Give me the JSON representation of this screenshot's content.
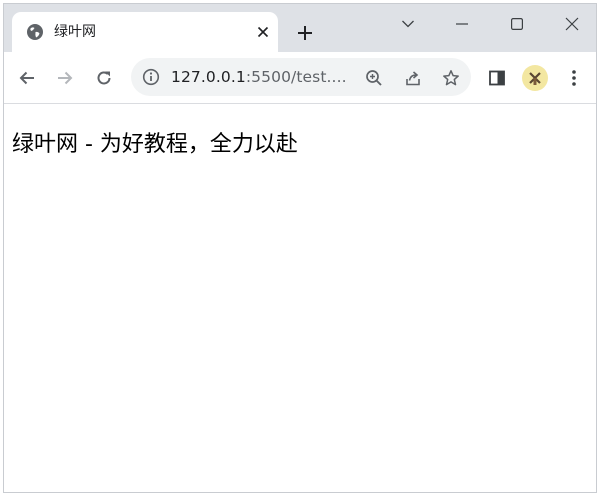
{
  "browser": {
    "tab": {
      "title": "绿叶网",
      "favicon": "globe-icon"
    },
    "toolbar": {
      "url_host": "127.0.0.1",
      "url_rest": ":5500/test...."
    },
    "colors": {
      "tabstrip": "#dee1e6",
      "omnibox": "#f1f3f4",
      "icon": "#5f6368"
    }
  },
  "page": {
    "heading_text": "绿叶网 - 为好教程，全力以赴"
  }
}
